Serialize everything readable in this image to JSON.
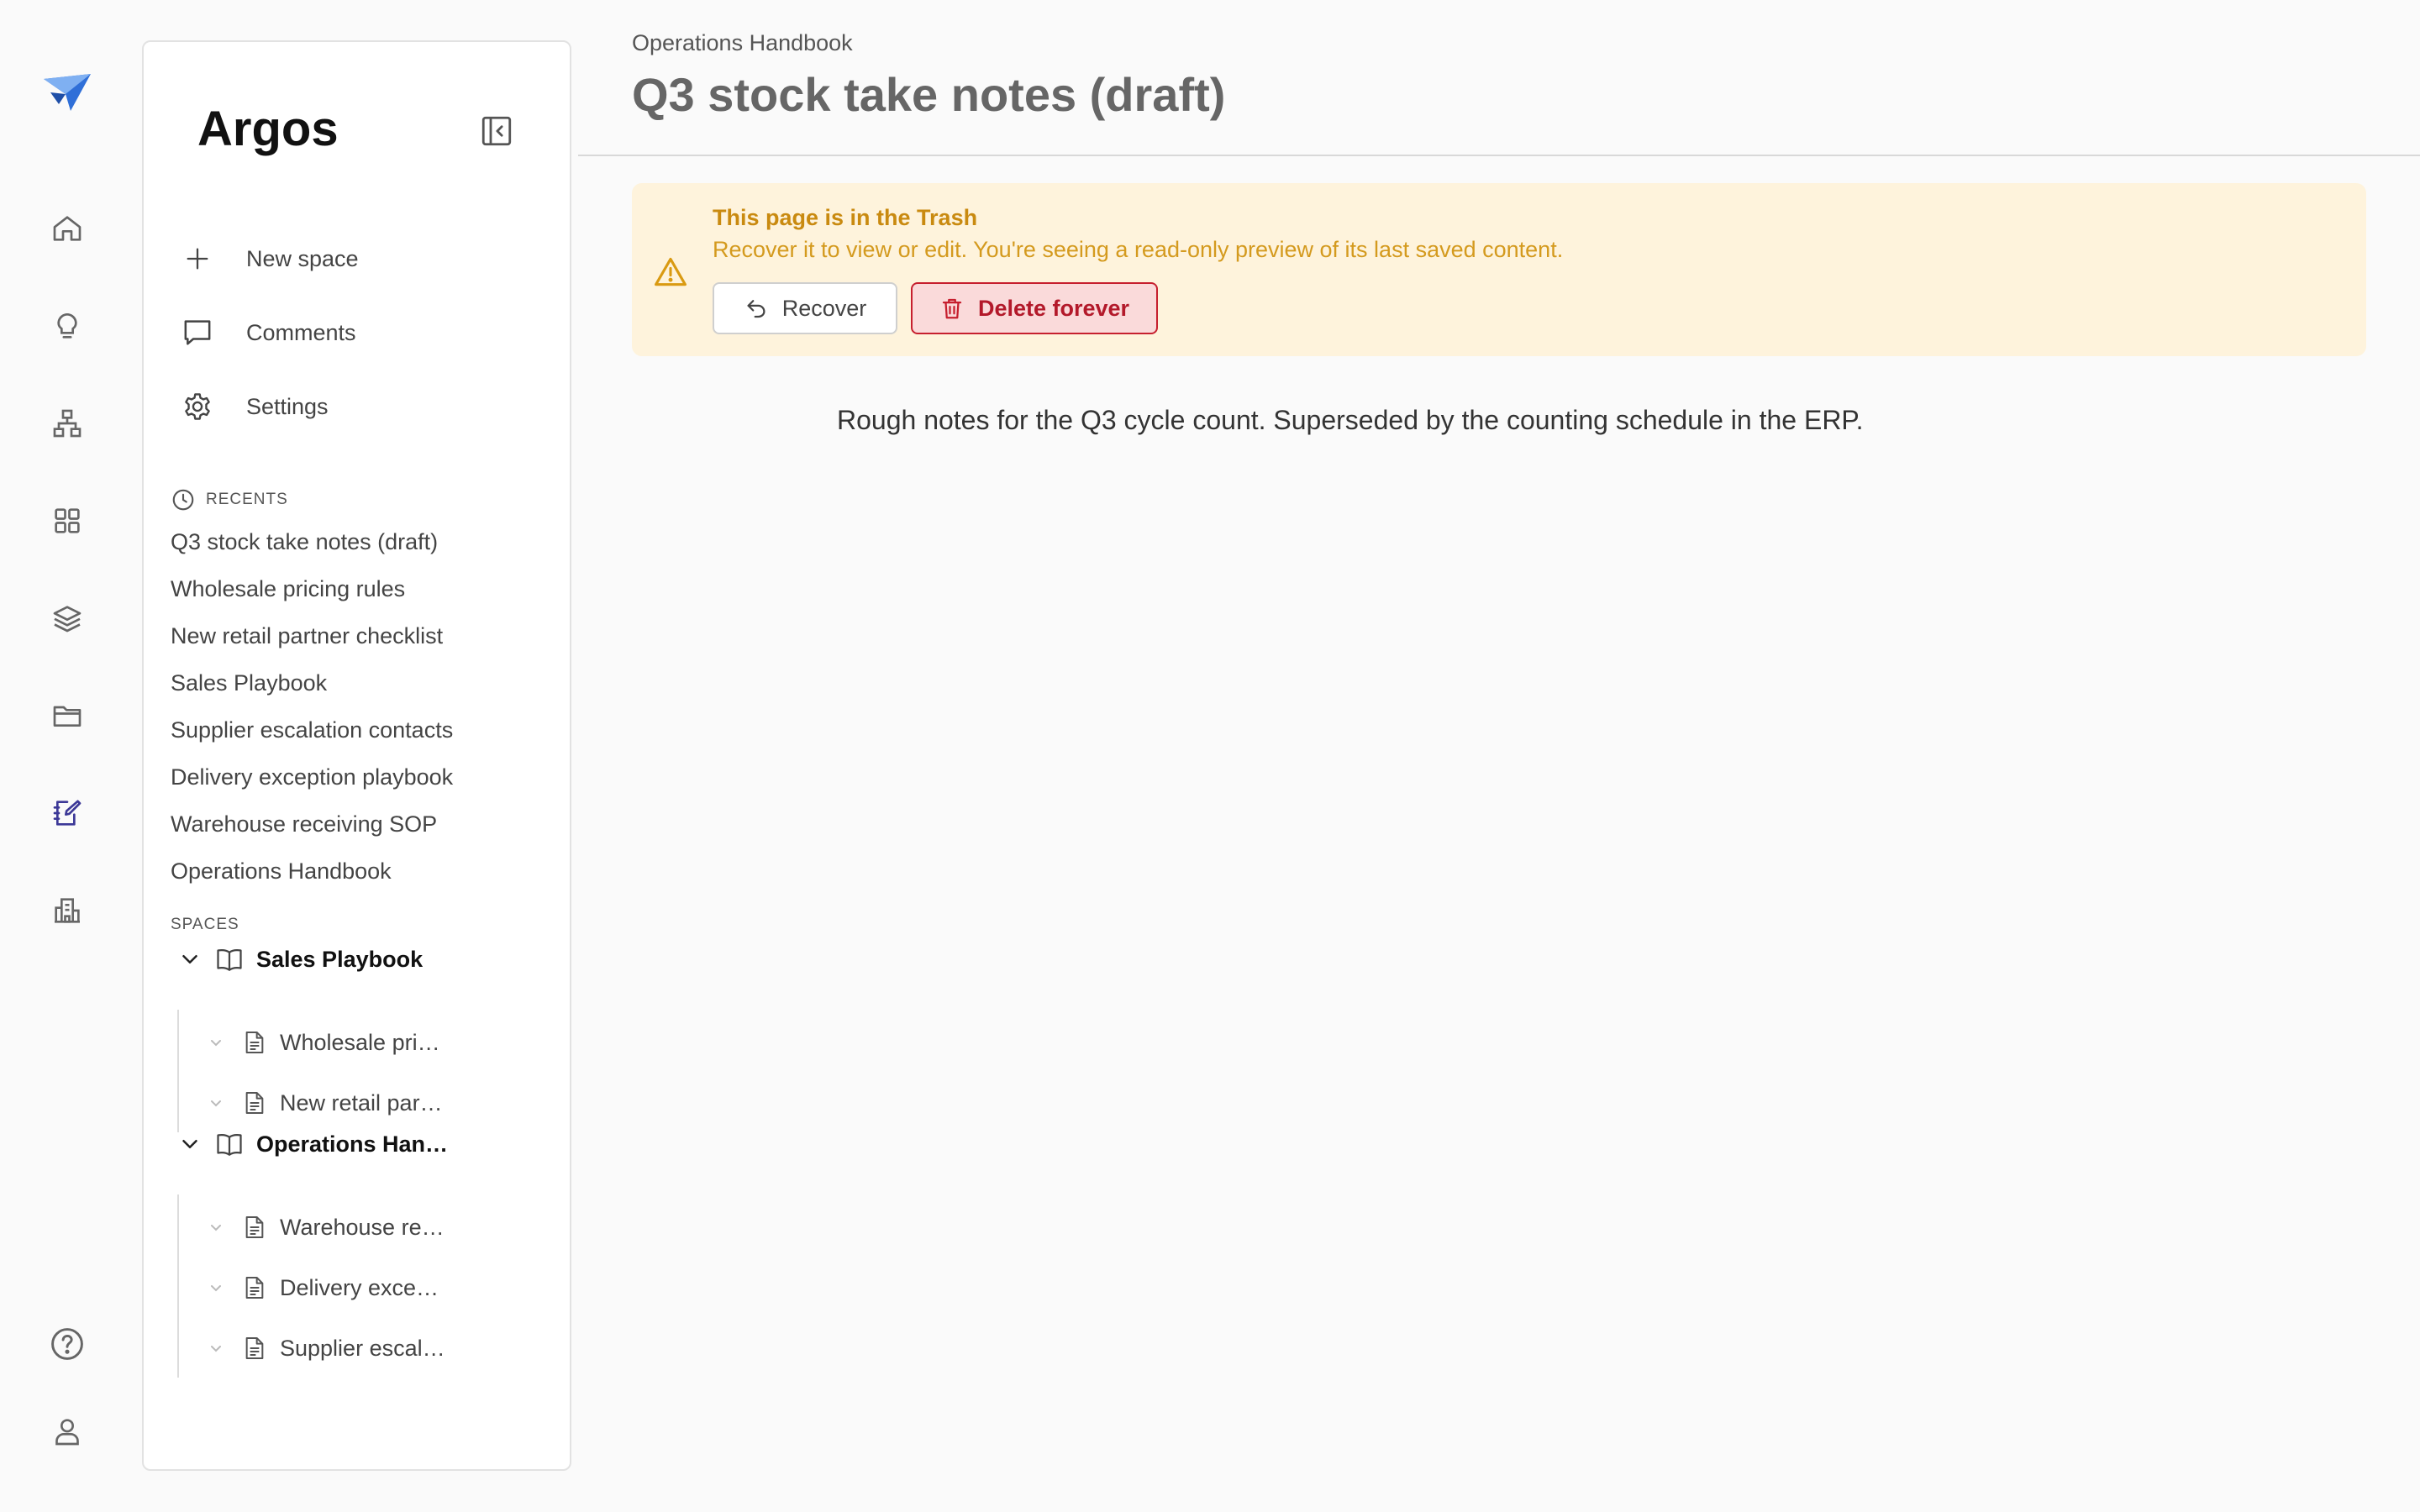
{
  "app": {
    "brand": "Argos"
  },
  "colors": {
    "accent": "#3c3897",
    "warning_bg": "#fef3dc",
    "warning_text": "#c98a10",
    "danger": "#c61f2e"
  },
  "rail": {
    "items": [
      {
        "name": "home-icon"
      },
      {
        "name": "lightbulb-icon"
      },
      {
        "name": "hierarchy-icon"
      },
      {
        "name": "grid-icon"
      },
      {
        "name": "layers-icon"
      },
      {
        "name": "folder-icon"
      },
      {
        "name": "notebook-edit-icon",
        "active": true
      },
      {
        "name": "building-icon"
      },
      {
        "name": "help-icon"
      },
      {
        "name": "user-icon"
      }
    ]
  },
  "sidebar": {
    "menu": [
      {
        "label": "New space",
        "icon": "plus-icon"
      },
      {
        "label": "Comments",
        "icon": "comment-icon"
      },
      {
        "label": "Settings",
        "icon": "gear-icon"
      }
    ],
    "recents_heading": "RECENTS",
    "recents": [
      "Q3 stock take notes (draft)",
      "Wholesale pricing rules",
      "New retail partner checklist",
      "Sales Playbook",
      "Supplier escalation contacts",
      "Delivery exception playbook",
      "Warehouse receiving SOP",
      "Operations Handbook"
    ],
    "spaces_heading": "SPACES",
    "spaces": [
      {
        "label": "Sales Playbook",
        "pages": [
          "Wholesale pri…",
          "New retail par…"
        ]
      },
      {
        "label": "Operations Han…",
        "pages": [
          "Warehouse re…",
          "Delivery exce…",
          "Supplier escal…"
        ]
      }
    ]
  },
  "main": {
    "breadcrumb": "Operations Handbook",
    "title": "Q3 stock take notes (draft)",
    "banner": {
      "title": "This page is in the Trash",
      "message": "Recover it to view or edit. You're seeing a read-only preview of its last saved content.",
      "recover_label": "Recover",
      "delete_label": "Delete forever"
    },
    "body": "Rough notes for the Q3 cycle count. Superseded by the counting schedule in the ERP."
  }
}
